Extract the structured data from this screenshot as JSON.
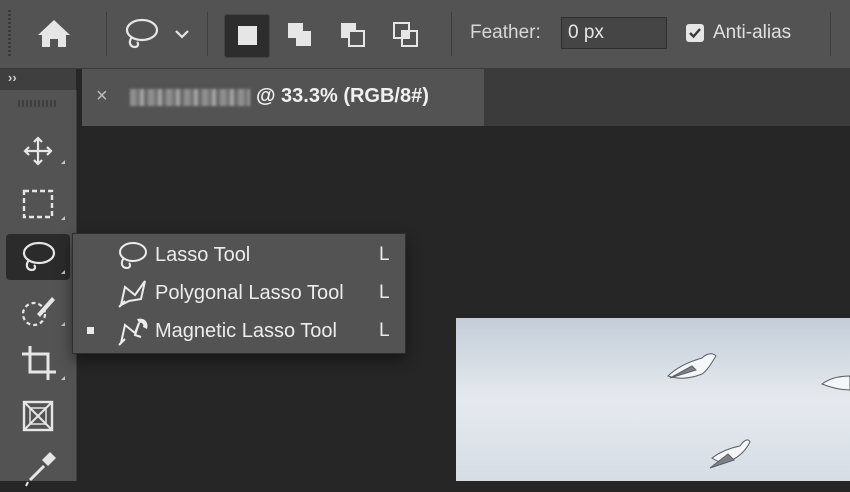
{
  "options_bar": {
    "home_icon": "home-icon",
    "tool_preset_icon": "lasso-icon",
    "selection_modes": [
      "new-selection",
      "add-to-selection",
      "subtract-from-selection",
      "intersect-with-selection"
    ],
    "active_mode": "new-selection",
    "feather_label": "Feather:",
    "feather_value": "0 px",
    "antialias_label": "Anti-alias",
    "antialias_checked": true
  },
  "toolbar": {
    "collapse_glyph": "››",
    "tools": [
      {
        "name": "move-tool",
        "icon": "move-icon"
      },
      {
        "name": "marquee-tool",
        "icon": "rectangle-marquee-icon"
      },
      {
        "name": "lasso-tool",
        "icon": "lasso-icon",
        "active": true
      },
      {
        "name": "quick-selection-tool",
        "icon": "quick-selection-icon"
      },
      {
        "name": "crop-tool",
        "icon": "crop-icon"
      },
      {
        "name": "frame-tool",
        "icon": "frame-icon"
      },
      {
        "name": "eyedropper-tool",
        "icon": "eyedropper-icon"
      }
    ]
  },
  "document_tab": {
    "close_glyph": "×",
    "title_suffix": "@ 33.3% (RGB/8#)"
  },
  "flyout": {
    "items": [
      {
        "label": "Lasso Tool",
        "shortcut": "L",
        "icon": "lasso-icon",
        "selected": false
      },
      {
        "label": "Polygonal Lasso Tool",
        "shortcut": "L",
        "icon": "polygonal-lasso-icon",
        "selected": false
      },
      {
        "label": "Magnetic Lasso Tool",
        "shortcut": "L",
        "icon": "magnetic-lasso-icon",
        "selected": true
      }
    ]
  },
  "colors": {
    "panel": "#535353",
    "canvas": "#262626",
    "text": "#ececec"
  }
}
